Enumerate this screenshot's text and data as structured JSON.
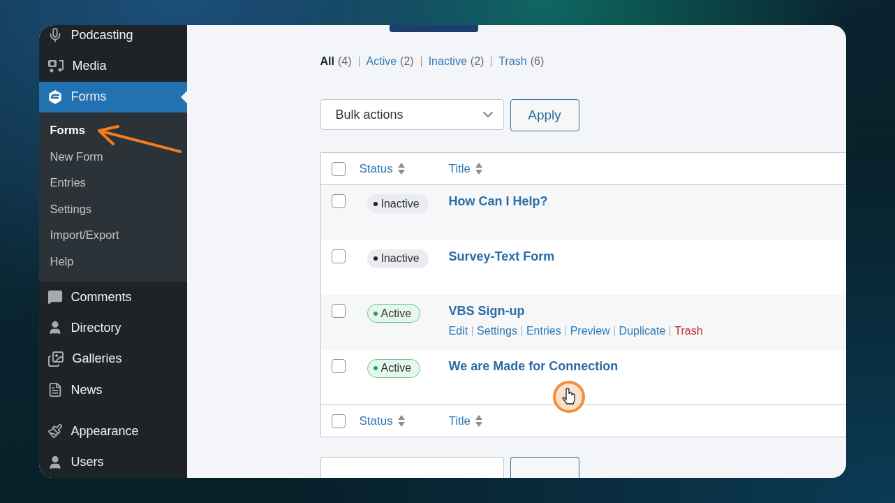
{
  "sidebar": {
    "items": [
      {
        "label": "Podcasting",
        "selected": false
      },
      {
        "label": "Media",
        "selected": false
      },
      {
        "label": "Forms",
        "selected": true,
        "children": [
          {
            "label": "Forms",
            "selected": true
          },
          {
            "label": "New Form",
            "selected": false
          },
          {
            "label": "Entries",
            "selected": false
          },
          {
            "label": "Settings",
            "selected": false
          },
          {
            "label": "Import/Export",
            "selected": false
          },
          {
            "label": "Help",
            "selected": false
          }
        ]
      },
      {
        "label": "Comments",
        "selected": false
      },
      {
        "label": "Directory",
        "selected": false
      },
      {
        "label": "Galleries",
        "selected": false
      },
      {
        "label": "News",
        "selected": false
      },
      {
        "label": "Appearance",
        "selected": false,
        "separator_before": true
      },
      {
        "label": "Users",
        "selected": false
      }
    ]
  },
  "filters": [
    {
      "label": "All",
      "count": "(4)",
      "selected": true
    },
    {
      "label": "Active",
      "count": "(2)",
      "selected": false
    },
    {
      "label": "Inactive",
      "count": "(2)",
      "selected": false
    },
    {
      "label": "Trash",
      "count": "(6)",
      "selected": false
    }
  ],
  "bulk": {
    "value": "Bulk actions",
    "button": "Apply"
  },
  "table": {
    "select_all": {
      "checked": false
    },
    "columns": [
      "Status",
      "Title"
    ],
    "rows": [
      {
        "checked": false,
        "status": {
          "label": "Inactive",
          "kind": "inactive"
        },
        "title": "How Can I Help?"
      },
      {
        "checked": false,
        "status": {
          "label": "Inactive",
          "kind": "inactive"
        },
        "title": "Survey-Text Form"
      },
      {
        "checked": false,
        "status": {
          "label": "Active",
          "kind": "active"
        },
        "title": "VBS Sign-up",
        "actions": [
          {
            "label": "Edit",
            "kind": "link"
          },
          {
            "label": "Settings",
            "kind": "link"
          },
          {
            "label": "Entries",
            "kind": "link"
          },
          {
            "label": "Preview",
            "kind": "link"
          },
          {
            "label": "Duplicate",
            "kind": "link"
          },
          {
            "label": "Trash",
            "kind": "danger"
          }
        ]
      },
      {
        "checked": false,
        "status": {
          "label": "Active",
          "kind": "active"
        },
        "title": "We are Made for Connection"
      }
    ],
    "footer_select_all": {
      "checked": false
    },
    "footer_columns": [
      "Status",
      "Title"
    ]
  }
}
